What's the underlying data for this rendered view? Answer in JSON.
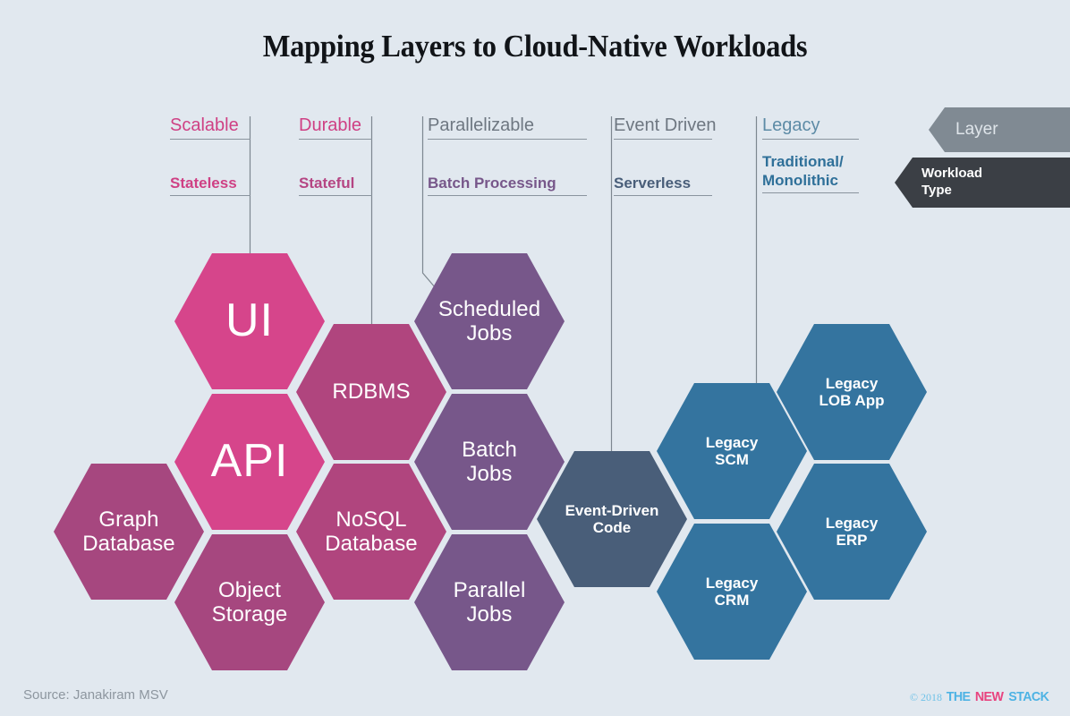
{
  "page": {
    "title": "Mapping Layers to Cloud-Native Workloads",
    "background": "#e1e8ef",
    "source": "Source: Janakiram MSV"
  },
  "legend": {
    "layer": {
      "label": "Layer",
      "color": "#808a93",
      "text_color": "#dfe5ea"
    },
    "workload": {
      "label": "Workload\nType",
      "color": "#3b3f45",
      "text_color": "#ffffff"
    }
  },
  "columns": [
    {
      "layer": "Scalable",
      "workload": "Stateless",
      "color": "#cf4084"
    },
    {
      "layer": "Durable",
      "workload": "Stateful",
      "color": "#b54583"
    },
    {
      "layer": "Parallelizable",
      "workload": "Batch Processing",
      "color": "#77578a"
    },
    {
      "layer": "Event Driven",
      "workload": "Serverless",
      "color": "#495e79"
    },
    {
      "layer": "Legacy",
      "workload": "Traditional/\nMonolithic",
      "color": "#2f7099"
    }
  ],
  "hexes": [
    {
      "label": "UI",
      "color": "#d6458b",
      "style": "huge"
    },
    {
      "label": "API",
      "color": "#d6458b",
      "style": "huge"
    },
    {
      "label": "Graph\nDatabase",
      "color": "#a6477f",
      "style": "light"
    },
    {
      "label": "Object\nStorage",
      "color": "#a6477f",
      "style": "light"
    },
    {
      "label": "RDBMS",
      "color": "#b0457e",
      "style": "light"
    },
    {
      "label": "NoSQL\nDatabase",
      "color": "#b0457e",
      "style": "light"
    },
    {
      "label": "Scheduled\nJobs",
      "color": "#77578a",
      "style": "light"
    },
    {
      "label": "Batch\nJobs",
      "color": "#77578a",
      "style": "light"
    },
    {
      "label": "Parallel\nJobs",
      "color": "#77578a",
      "style": "light"
    },
    {
      "label": "Event-Driven\nCode",
      "color": "#495e79",
      "style": "bold"
    },
    {
      "label": "Legacy\nSCM",
      "color": "#34749f",
      "style": "bold"
    },
    {
      "label": "Legacy\nCRM",
      "color": "#34749f",
      "style": "bold"
    },
    {
      "label": "Legacy\nLOB App",
      "color": "#34749f",
      "style": "bold"
    },
    {
      "label": "Legacy\nERP",
      "color": "#34749f",
      "style": "bold"
    }
  ],
  "logo": {
    "copyright": "© 2018",
    "the": "THE",
    "new": "NEW",
    "stack": "STACK",
    "blue": "#4eb3e4",
    "pink": "#e8437f"
  }
}
